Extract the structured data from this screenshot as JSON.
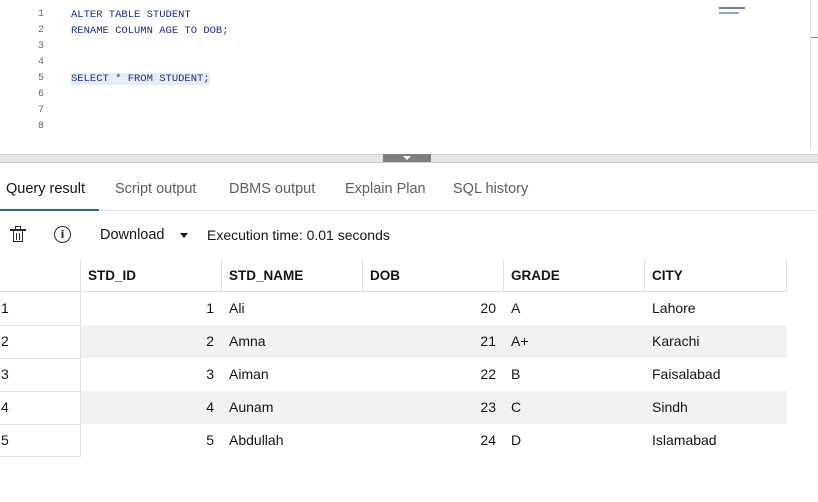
{
  "editor": {
    "line_numbers": [
      "1",
      "2",
      "3",
      "4",
      "5",
      "6",
      "7",
      "8"
    ],
    "lines": [
      "ALTER TABLE STUDENT",
      "RENAME COLUMN AGE TO DOB;",
      "",
      "",
      "SELECT * FROM STUDENT;",
      "",
      "",
      ""
    ]
  },
  "tabs": [
    {
      "label": "Query result",
      "active": true
    },
    {
      "label": "Script output",
      "active": false
    },
    {
      "label": "DBMS output",
      "active": false
    },
    {
      "label": "Explain Plan",
      "active": false
    },
    {
      "label": "SQL history",
      "active": false
    }
  ],
  "toolbar": {
    "delete_icon": "trash-icon",
    "info_icon": "info-icon",
    "download_label": "Download",
    "execution_time": "Execution time: 0.01 seconds"
  },
  "grid": {
    "columns": [
      "STD_ID",
      "STD_NAME",
      "DOB",
      "GRADE",
      "CITY"
    ],
    "rows": [
      {
        "index": "1",
        "std_id": "1",
        "std_name": "Ali",
        "dob": "20",
        "grade": "A",
        "city": "Lahore"
      },
      {
        "index": "2",
        "std_id": "2",
        "std_name": "Amna",
        "dob": "21",
        "grade": "A+",
        "city": "Karachi"
      },
      {
        "index": "3",
        "std_id": "3",
        "std_name": "Aiman",
        "dob": "22",
        "grade": "B",
        "city": "Faisalabad"
      },
      {
        "index": "4",
        "std_id": "4",
        "std_name": "Aunam",
        "dob": "23",
        "grade": "C",
        "city": "Sindh"
      },
      {
        "index": "5",
        "std_id": "5",
        "std_name": "Abdullah",
        "dob": "24",
        "grade": "D",
        "city": "Islamabad"
      }
    ]
  },
  "colors": {
    "accent_underline": "#2f6f6a",
    "sql_keyword": "#1a2d8f",
    "row_alt": "#f3f2f1"
  }
}
